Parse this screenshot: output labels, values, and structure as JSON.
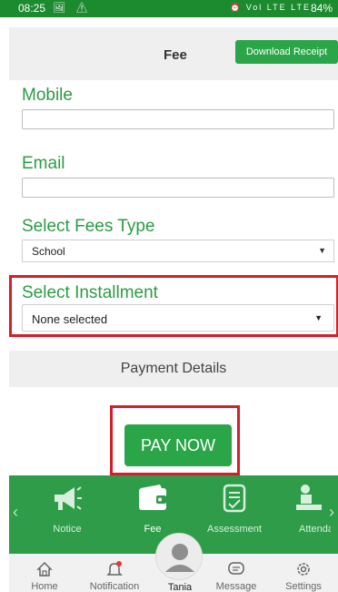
{
  "status_bar": {
    "time": "08:25",
    "left_icons": "🖼 ⚠",
    "right_icons": "⏰ Vol LTE LTE",
    "battery": "84%"
  },
  "header": {
    "title": "Fee",
    "download_label": "Download Receipt"
  },
  "form": {
    "mobile_label": "Mobile",
    "mobile_value": "",
    "email_label": "Email",
    "email_value": "",
    "fees_type_label": "Select Fees Type",
    "fees_type_value": "School",
    "installment_label": "Select Installment",
    "installment_value": "None selected"
  },
  "payment_details": "Payment Details",
  "pay_now": "PAY NOW",
  "bottom_tabs": [
    {
      "label": "Notice",
      "icon": "megaphone-icon"
    },
    {
      "label": "Fee",
      "icon": "wallet-icon"
    },
    {
      "label": "Assessment",
      "icon": "clipboard-icon"
    },
    {
      "label": "Attenda",
      "icon": "attendance-icon"
    }
  ],
  "nav": [
    {
      "label": "Home",
      "icon": "home-icon"
    },
    {
      "label": "Notification",
      "icon": "bell-icon"
    },
    {
      "label": "Tania",
      "icon": "avatar"
    },
    {
      "label": "Message",
      "icon": "message-icon"
    },
    {
      "label": "Settings",
      "icon": "gear-icon"
    }
  ],
  "colors": {
    "brand_green": "#2aa548",
    "label_green": "#2c9b43",
    "highlight_red": "#d21f28",
    "status_bar": "#1c8a2f"
  }
}
